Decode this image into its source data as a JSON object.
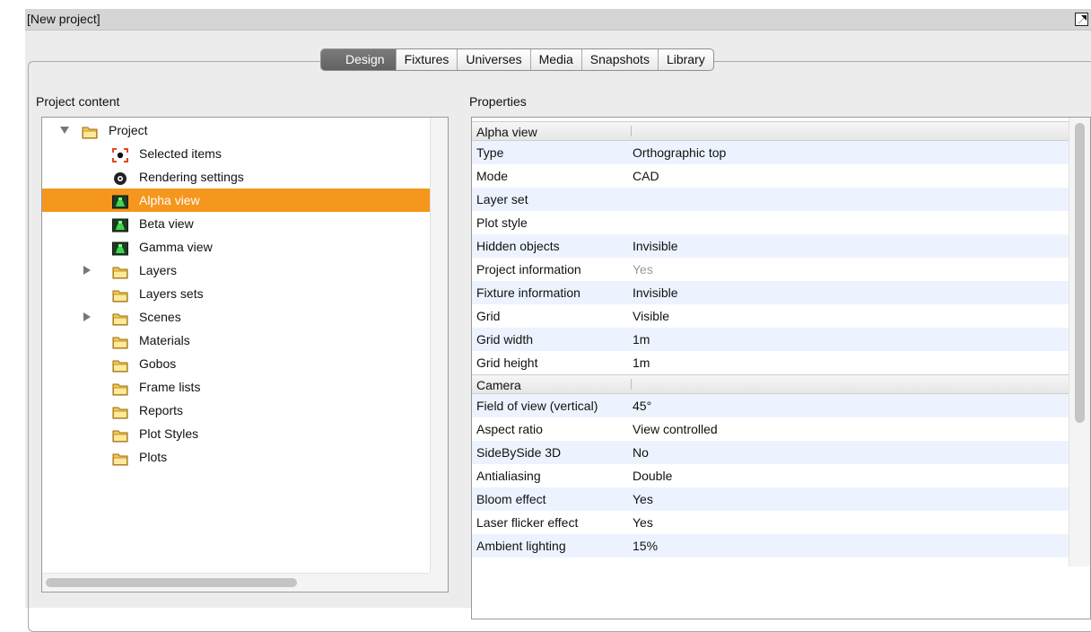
{
  "window": {
    "title": "[New project]"
  },
  "tabs": [
    {
      "label": "Design",
      "active": true
    },
    {
      "label": "Fixtures",
      "active": false
    },
    {
      "label": "Universes",
      "active": false
    },
    {
      "label": "Media",
      "active": false
    },
    {
      "label": "Snapshots",
      "active": false
    },
    {
      "label": "Library",
      "active": false
    }
  ],
  "project_content": {
    "heading": "Project content",
    "items": [
      {
        "label": "Project",
        "icon": "folder-icon",
        "expander": "expanded"
      },
      {
        "label": "Selected items",
        "icon": "selected-items-icon",
        "expander": "none"
      },
      {
        "label": "Rendering settings",
        "icon": "rendering-settings-icon",
        "expander": "none"
      },
      {
        "label": "Alpha view",
        "icon": "view-icon",
        "expander": "none",
        "selected": true
      },
      {
        "label": "Beta view",
        "icon": "view-icon",
        "expander": "none"
      },
      {
        "label": "Gamma view",
        "icon": "view-icon",
        "expander": "none"
      },
      {
        "label": "Layers",
        "icon": "folder-icon",
        "expander": "collapsed"
      },
      {
        "label": "Layers sets",
        "icon": "folder-icon",
        "expander": "none"
      },
      {
        "label": "Scenes",
        "icon": "folder-icon",
        "expander": "collapsed"
      },
      {
        "label": "Materials",
        "icon": "folder-icon",
        "expander": "none"
      },
      {
        "label": "Gobos",
        "icon": "folder-icon",
        "expander": "none"
      },
      {
        "label": "Frame lists",
        "icon": "folder-icon",
        "expander": "none"
      },
      {
        "label": "Reports",
        "icon": "folder-icon",
        "expander": "none"
      },
      {
        "label": "Plot Styles",
        "icon": "folder-icon",
        "expander": "none"
      },
      {
        "label": "Plots",
        "icon": "folder-icon",
        "expander": "none"
      }
    ]
  },
  "properties": {
    "heading": "Properties",
    "rows": [
      {
        "kind": "header",
        "key": "Alpha view",
        "value": ""
      },
      {
        "kind": "prop",
        "key": "Type",
        "value": "Orthographic top"
      },
      {
        "kind": "prop",
        "key": "Mode",
        "value": "CAD"
      },
      {
        "kind": "prop",
        "key": "Layer set",
        "value": ""
      },
      {
        "kind": "prop",
        "key": "Plot style",
        "value": ""
      },
      {
        "kind": "prop",
        "key": "Hidden objects",
        "value": "Invisible"
      },
      {
        "kind": "prop",
        "key": "Project information",
        "value": "Yes",
        "disabled": true
      },
      {
        "kind": "prop",
        "key": "Fixture information",
        "value": "Invisible"
      },
      {
        "kind": "prop",
        "key": "Grid",
        "value": "Visible"
      },
      {
        "kind": "prop",
        "key": "Grid width",
        "value": "1m"
      },
      {
        "kind": "prop",
        "key": "Grid height",
        "value": "1m"
      },
      {
        "kind": "header",
        "key": "Camera",
        "value": ""
      },
      {
        "kind": "prop",
        "key": "Field of view (vertical)",
        "value": "45°"
      },
      {
        "kind": "prop",
        "key": "Aspect ratio",
        "value": "View controlled"
      },
      {
        "kind": "prop",
        "key": "SideBySide 3D",
        "value": "No"
      },
      {
        "kind": "prop",
        "key": "Antialiasing",
        "value": "Double"
      },
      {
        "kind": "prop",
        "key": "Bloom effect",
        "value": "Yes"
      },
      {
        "kind": "prop",
        "key": "Laser flicker effect",
        "value": "Yes"
      },
      {
        "kind": "prop",
        "key": "Ambient lighting",
        "value": "15%"
      }
    ]
  },
  "colors": {
    "selection": "#f5961d",
    "alt_row": "#edf3fe",
    "active_tab": "#6e6e6e"
  }
}
